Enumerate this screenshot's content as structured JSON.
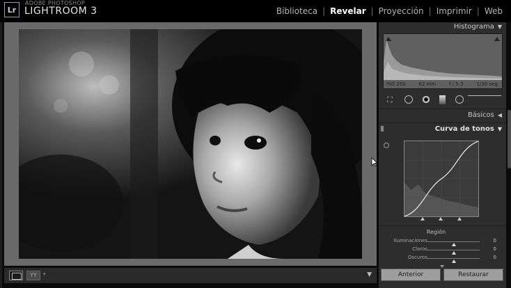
{
  "app": {
    "brand_line1": "ADOBE PHOTOSHOP",
    "brand_line2": "LIGHTROOM 3",
    "logo_text": "Lr"
  },
  "modules": [
    {
      "label": "Biblioteca",
      "active": false
    },
    {
      "label": "Revelar",
      "active": true
    },
    {
      "label": "Proyección",
      "active": false
    },
    {
      "label": "Imprimir",
      "active": false
    },
    {
      "label": "Web",
      "active": false
    }
  ],
  "panels": {
    "histogram": {
      "title": "Histograma",
      "exif": [
        "ISO 250",
        "62 mm",
        "f / 5.3",
        "1/30 seg."
      ]
    },
    "basic": {
      "title": "Básicos"
    },
    "tone_curve": {
      "title": "Curva de tonos",
      "region_label": "Región",
      "sliders": [
        {
          "label": "Iluminaciones",
          "value": "0"
        },
        {
          "label": "Claros",
          "value": "0"
        },
        {
          "label": "Oscuros",
          "value": "0"
        }
      ]
    }
  },
  "buttons": {
    "previous": "Anterior",
    "reset": "Restaurar"
  },
  "icons": {
    "expand": "▼",
    "collapse": "◀",
    "menu": "▾"
  }
}
